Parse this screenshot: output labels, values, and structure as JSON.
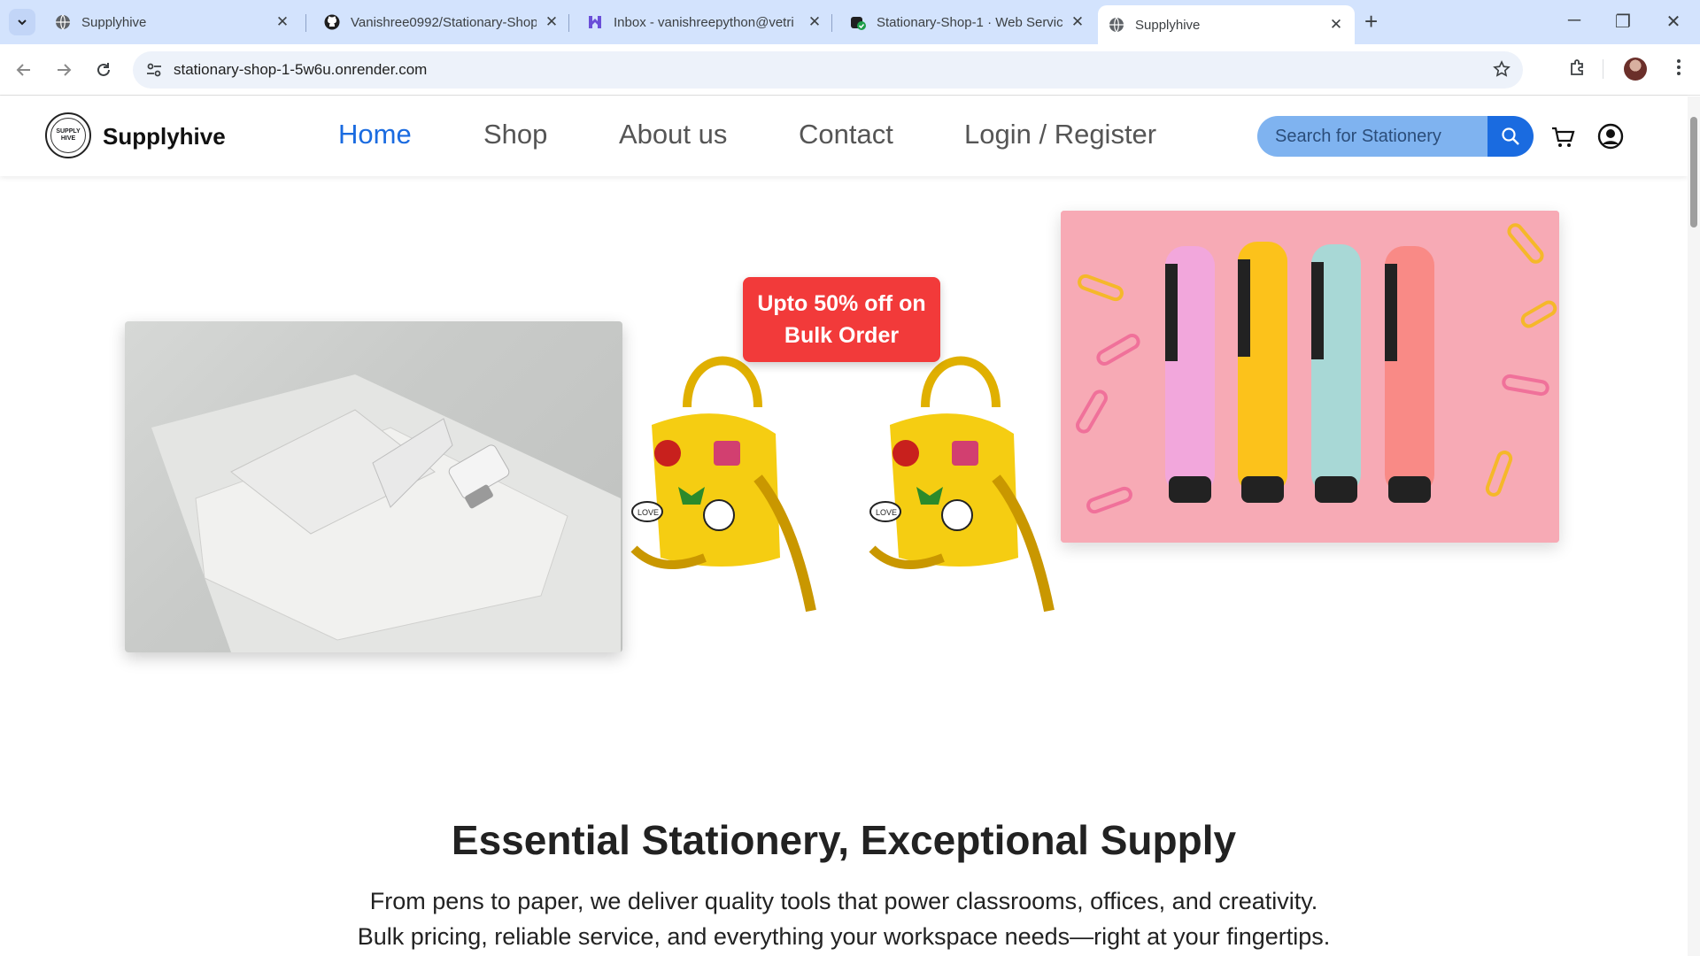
{
  "browser": {
    "tabs": [
      {
        "title": "Supplyhive",
        "icon": "globe-icon",
        "active": false
      },
      {
        "title": "Vanishree0992/Stationary-Shop",
        "icon": "github-icon",
        "active": false
      },
      {
        "title": "Inbox - vanishreepython@vetri",
        "icon": "mail-icon",
        "active": false
      },
      {
        "title": "Stationary-Shop-1 · Web Servic",
        "icon": "render-icon",
        "active": false
      },
      {
        "title": "Supplyhive",
        "icon": "globe-icon",
        "active": true
      }
    ],
    "url": "stationary-shop-1-5w6u.onrender.com"
  },
  "header": {
    "brand": "Supplyhive",
    "logo_text_top": "SUPPLY",
    "logo_text_bottom": "HIVE",
    "nav": [
      {
        "label": "Home",
        "active": true
      },
      {
        "label": "Shop",
        "active": false
      },
      {
        "label": "About us",
        "active": false
      },
      {
        "label": "Contact",
        "active": false
      },
      {
        "label": "Login / Register",
        "active": false
      }
    ],
    "search_placeholder": "Search for Stationery"
  },
  "hero": {
    "badge_line1": "Upto 50% off on",
    "badge_line2": "Bulk Order",
    "bag_sticker": "LOVE"
  },
  "intro": {
    "headline": "Essential Stationery, Exceptional Supply",
    "line1": "From pens to paper, we deliver quality tools that power classrooms, offices, and creativity.",
    "line2": "Bulk pricing, reliable service, and everything your workspace needs—right at your fingertips."
  },
  "colors": {
    "accent": "#1a6be0",
    "search_bg": "#7fb3f0",
    "badge": "#f23a3a",
    "tabstrip": "#d3e3fd"
  }
}
